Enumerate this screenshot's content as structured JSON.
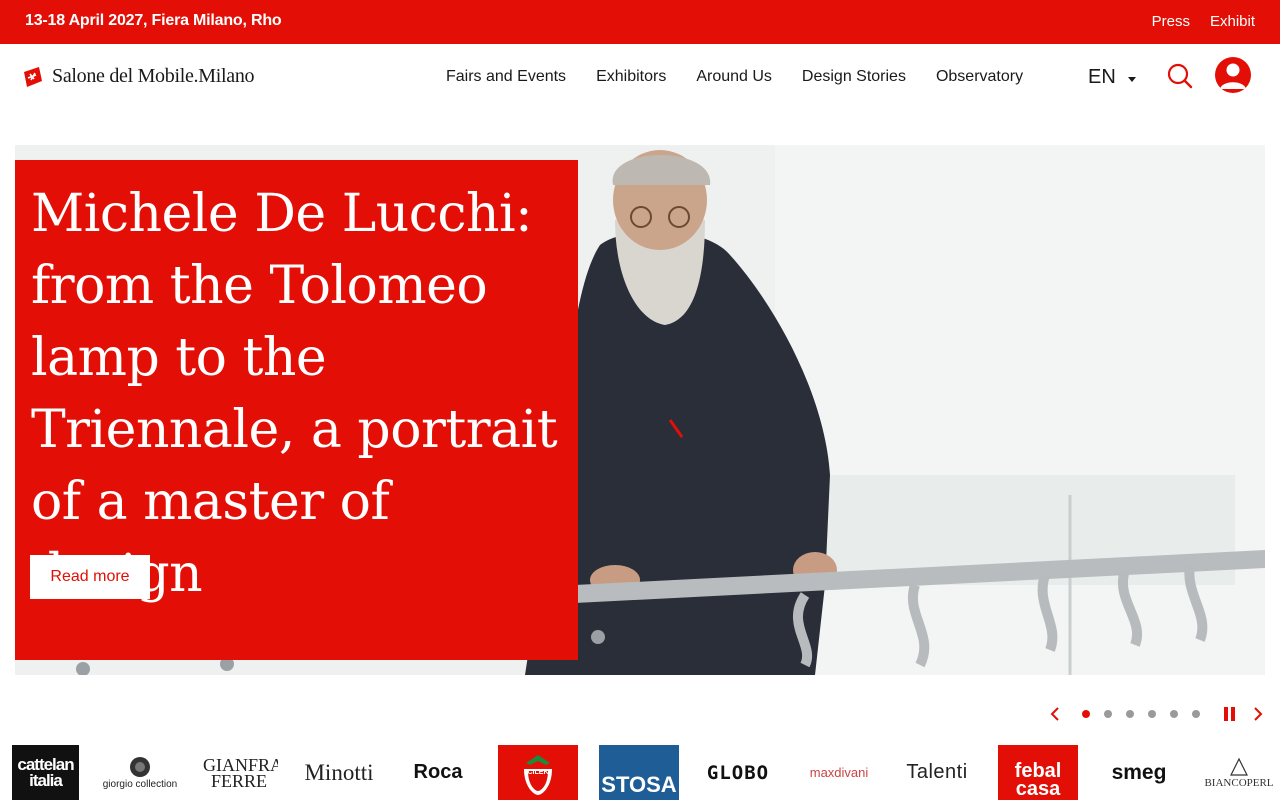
{
  "topbar": {
    "date_location": "13-18 April 2027, Fiera Milano, Rho",
    "press_label": "Press",
    "exhibit_label": "Exhibit"
  },
  "header": {
    "logo_text": "Salone del Mobile.Milano",
    "nav": [
      "Fairs and Events",
      "Exhibitors",
      "Around Us",
      "Design Stories",
      "Observatory"
    ],
    "language": "EN"
  },
  "hero": {
    "title": "Michele De Lucchi: from the Tolomeo lamp to the Triennale, a portrait of a master of design",
    "cta_label": "Read more"
  },
  "carousel": {
    "slide_count": 6,
    "active_index": 0
  },
  "brands": [
    "cattelan italia",
    "giorgio collection",
    "GIANFRANCO FERRE",
    "Minotti",
    "Roca",
    "CILEK",
    "STOSA",
    "GLOBO",
    "maxdivani",
    "Talenti",
    "febal casa",
    "smeg",
    "BIANCOPERL"
  ],
  "colors": {
    "brand_red": "#e30f06",
    "text_dark": "#1a1a1a",
    "stosa_blue": "#1f5d96"
  }
}
